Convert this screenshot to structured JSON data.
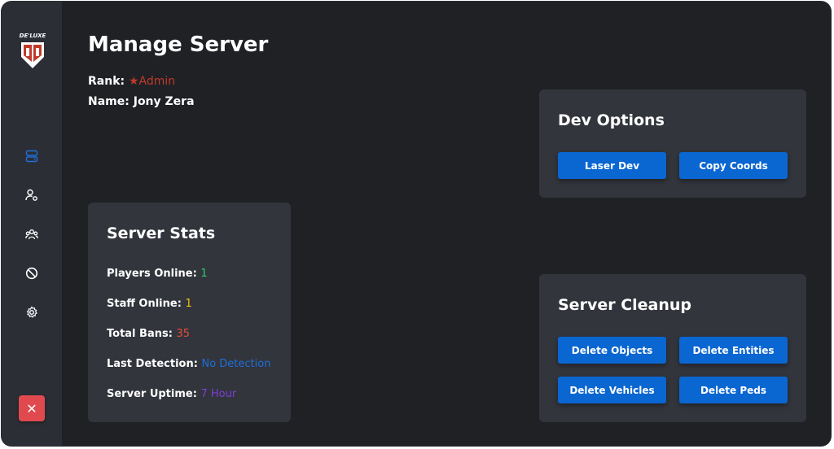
{
  "app": {
    "logo_text": "DE'LUXE",
    "title": "Manage Server"
  },
  "user": {
    "rank_label": "Rank:",
    "rank_value": "Admin",
    "name_label": "Name:",
    "name_value": "Jony Zera"
  },
  "sidebar": {
    "items": [
      {
        "icon": "server-icon"
      },
      {
        "icon": "user-gear-icon"
      },
      {
        "icon": "users-icon"
      },
      {
        "icon": "ban-icon"
      },
      {
        "icon": "gear-icon"
      }
    ],
    "close_label": "✕"
  },
  "server_stats": {
    "title": "Server Stats",
    "players_online_label": "Players Online:",
    "players_online_value": "1",
    "staff_online_label": "Staff Online:",
    "staff_online_value": "1",
    "total_bans_label": "Total Bans:",
    "total_bans_value": "35",
    "last_detection_label": "Last Detection:",
    "last_detection_value": "No Detection",
    "uptime_label": "Server Uptime:",
    "uptime_value": "7 Hour"
  },
  "dev_options": {
    "title": "Dev Options",
    "laser_dev_label": "Laser Dev",
    "copy_coords_label": "Copy Coords"
  },
  "server_cleanup": {
    "title": "Server Cleanup",
    "delete_objects_label": "Delete Objects",
    "delete_entities_label": "Delete Entities",
    "delete_vehicles_label": "Delete Vehicles",
    "delete_peds_label": "Delete Peds"
  },
  "colors": {
    "accent": "#0a66d1",
    "rank": "#c0392b",
    "players": "#2ecc71",
    "staff": "#f1c40f",
    "bans": "#e74c3c",
    "detection": "#1e6fd9",
    "uptime": "#7b3fd6",
    "close": "#e04a4f"
  }
}
